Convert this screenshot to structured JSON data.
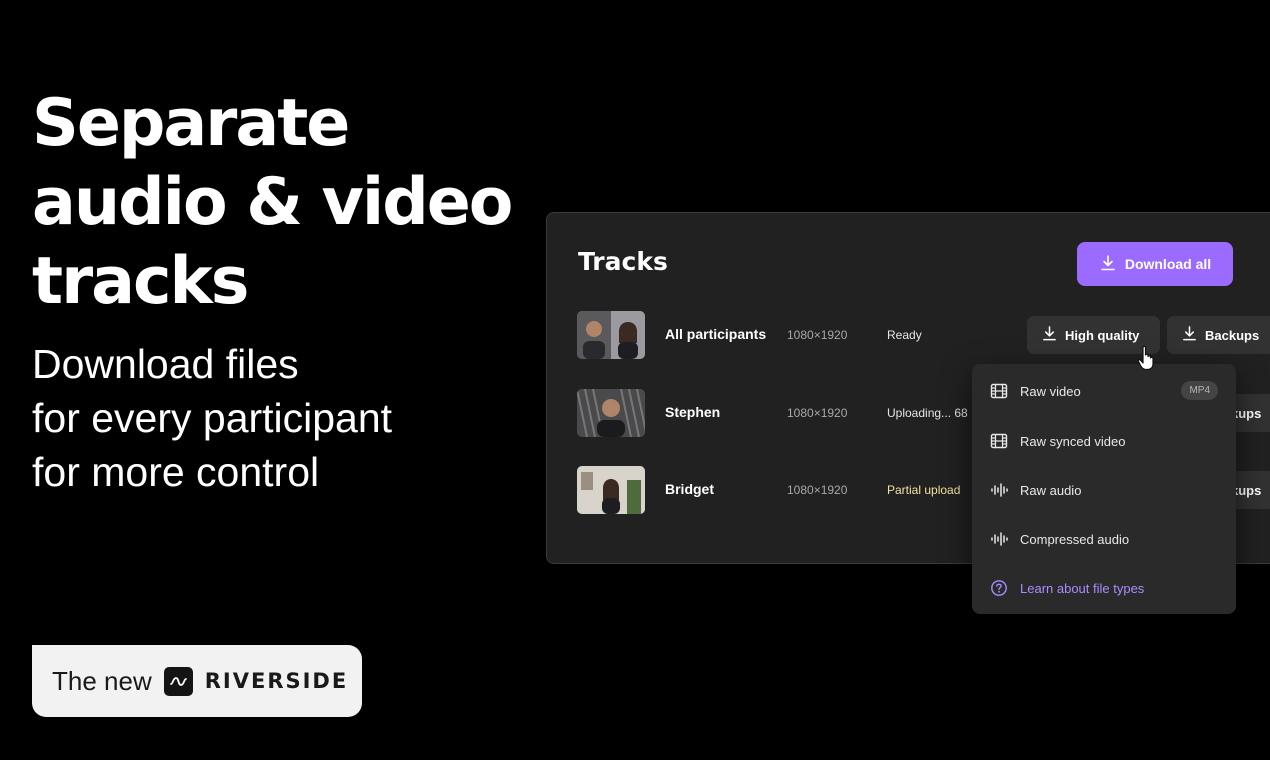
{
  "hero": {
    "title_lines": [
      "Separate",
      "audio & video",
      "tracks"
    ],
    "subtitle_lines": [
      "Download files",
      "for every participant",
      "for more control"
    ]
  },
  "badge": {
    "prefix": "The new",
    "brand": "RIVERSIDE",
    "logo_icon": "waveform-logo-icon"
  },
  "panel": {
    "title": "Tracks",
    "download_all_label": "Download all",
    "rows": [
      {
        "name": "All participants",
        "resolution": "1080×1920",
        "status": "Ready",
        "high_quality_label": "High quality",
        "backups_label": "Backups"
      },
      {
        "name": "Stephen",
        "resolution": "1080×1920",
        "status": "Uploading... 68",
        "backups_label": "kups"
      },
      {
        "name": "Bridget",
        "resolution": "1080×1920",
        "status": "Partial upload",
        "backups_label": "kups"
      }
    ]
  },
  "dropdown": {
    "items": [
      {
        "label": "Raw video",
        "icon": "film-icon",
        "badge": "MP4"
      },
      {
        "label": "Raw synced video",
        "icon": "film-icon"
      },
      {
        "label": "Raw audio",
        "icon": "audio-wave-icon"
      },
      {
        "label": "Compressed audio",
        "icon": "audio-wave-icon"
      },
      {
        "label": "Learn about file types",
        "icon": "help-circle-icon"
      }
    ]
  },
  "colors": {
    "accent": "#9b6bff",
    "link": "#a98cff",
    "warning": "#f4e2a0",
    "panel_bg": "#212121",
    "page_bg": "#000000"
  }
}
